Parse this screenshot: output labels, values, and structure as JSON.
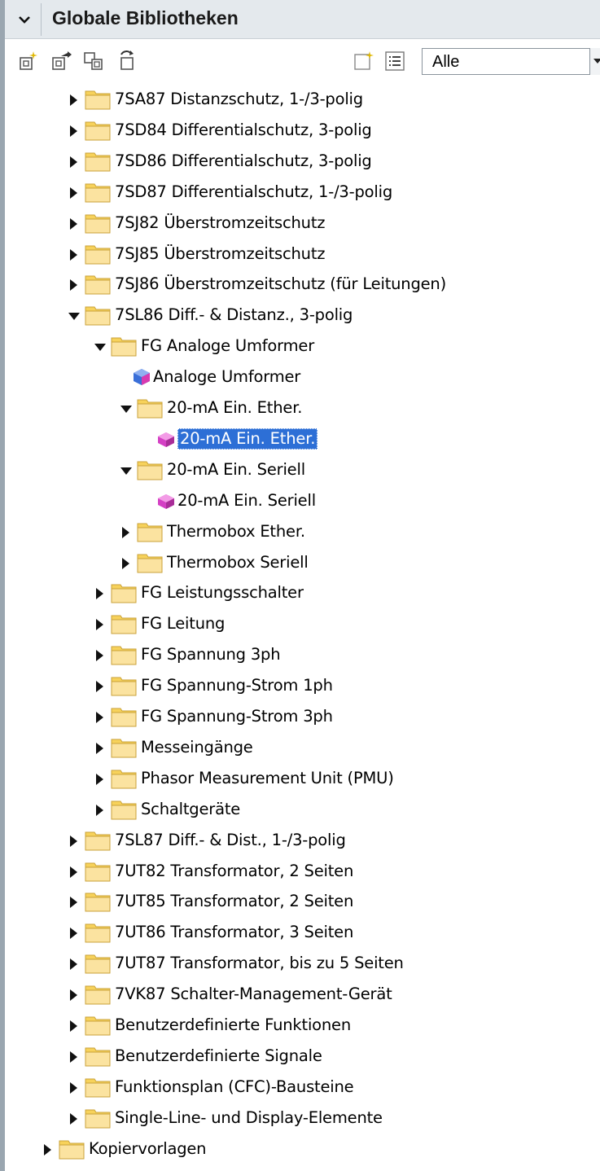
{
  "header": {
    "title": "Globale Bibliotheken"
  },
  "toolbar": {
    "filter_value": "Alle",
    "icons": [
      "new-library-icon",
      "open-library-icon",
      "copy-library-icon",
      "update-library-icon",
      "new-folder-icon",
      "details-view-icon"
    ]
  },
  "tree": [
    {
      "label": "7SA87 Distanzschutz, 1-/3-polig",
      "level": 0,
      "state": "collapsed",
      "kind": "folder"
    },
    {
      "label": "7SD84 Differentialschutz, 3-polig",
      "level": 0,
      "state": "collapsed",
      "kind": "folder"
    },
    {
      "label": "7SD86 Differentialschutz, 3-polig",
      "level": 0,
      "state": "collapsed",
      "kind": "folder"
    },
    {
      "label": "7SD87 Differentialschutz, 1-/3-polig",
      "level": 0,
      "state": "collapsed",
      "kind": "folder"
    },
    {
      "label": "7SJ82 Überstromzeitschutz",
      "level": 0,
      "state": "collapsed",
      "kind": "folder"
    },
    {
      "label": "7SJ85 Überstromzeitschutz",
      "level": 0,
      "state": "collapsed",
      "kind": "folder"
    },
    {
      "label": "7SJ86 Überstromzeitschutz (für Leitungen)",
      "level": 0,
      "state": "collapsed",
      "kind": "folder"
    },
    {
      "label": "7SL86 Diff.- & Distanz., 3-polig",
      "level": 0,
      "state": "expanded",
      "kind": "folder"
    },
    {
      "label": "FG Analoge Umformer",
      "level": 1,
      "state": "expanded",
      "kind": "folder"
    },
    {
      "label": "Analoge Umformer",
      "level": 2,
      "state": "leaf",
      "kind": "block-blue"
    },
    {
      "label": "20-mA Ein. Ether.",
      "level": 2,
      "state": "expanded",
      "kind": "folder"
    },
    {
      "label": "20-mA Ein. Ether.",
      "level": 3,
      "state": "leaf",
      "kind": "block-pink",
      "selected": true
    },
    {
      "label": "20-mA Ein. Seriell",
      "level": 2,
      "state": "expanded",
      "kind": "folder"
    },
    {
      "label": "20-mA Ein. Seriell",
      "level": 3,
      "state": "leaf",
      "kind": "block-pink"
    },
    {
      "label": "Thermobox Ether.",
      "level": 2,
      "state": "collapsed",
      "kind": "folder"
    },
    {
      "label": "Thermobox Seriell",
      "level": 2,
      "state": "collapsed",
      "kind": "folder"
    },
    {
      "label": "FG Leistungsschalter",
      "level": 1,
      "state": "collapsed",
      "kind": "folder"
    },
    {
      "label": "FG Leitung",
      "level": 1,
      "state": "collapsed",
      "kind": "folder"
    },
    {
      "label": "FG Spannung 3ph",
      "level": 1,
      "state": "collapsed",
      "kind": "folder"
    },
    {
      "label": "FG Spannung-Strom 1ph",
      "level": 1,
      "state": "collapsed",
      "kind": "folder"
    },
    {
      "label": "FG Spannung-Strom 3ph",
      "level": 1,
      "state": "collapsed",
      "kind": "folder"
    },
    {
      "label": "Messeingänge",
      "level": 1,
      "state": "collapsed",
      "kind": "folder"
    },
    {
      "label": "Phasor Measurement Unit (PMU)",
      "level": 1,
      "state": "collapsed",
      "kind": "folder"
    },
    {
      "label": "Schaltgeräte",
      "level": 1,
      "state": "collapsed",
      "kind": "folder"
    },
    {
      "label": "7SL87 Diff.- & Dist., 1-/3-polig",
      "level": 0,
      "state": "collapsed",
      "kind": "folder"
    },
    {
      "label": "7UT82 Transformator, 2 Seiten",
      "level": 0,
      "state": "collapsed",
      "kind": "folder"
    },
    {
      "label": "7UT85 Transformator, 2 Seiten",
      "level": 0,
      "state": "collapsed",
      "kind": "folder"
    },
    {
      "label": "7UT86 Transformator, 3 Seiten",
      "level": 0,
      "state": "collapsed",
      "kind": "folder"
    },
    {
      "label": "7UT87 Transformator, bis zu 5 Seiten",
      "level": 0,
      "state": "collapsed",
      "kind": "folder"
    },
    {
      "label": "7VK87 Schalter-Management-Gerät",
      "level": 0,
      "state": "collapsed",
      "kind": "folder"
    },
    {
      "label": "Benutzerdefinierte Funktionen",
      "level": 0,
      "state": "collapsed",
      "kind": "folder"
    },
    {
      "label": "Benutzerdefinierte Signale",
      "level": 0,
      "state": "collapsed",
      "kind": "folder"
    },
    {
      "label": "Funktionsplan (CFC)-Bausteine",
      "level": 0,
      "state": "collapsed",
      "kind": "folder"
    },
    {
      "label": "Single-Line- und Display-Elemente",
      "level": 0,
      "state": "collapsed",
      "kind": "folder"
    },
    {
      "label": "Kopiervorlagen",
      "level": -1,
      "state": "collapsed",
      "kind": "folder"
    }
  ]
}
